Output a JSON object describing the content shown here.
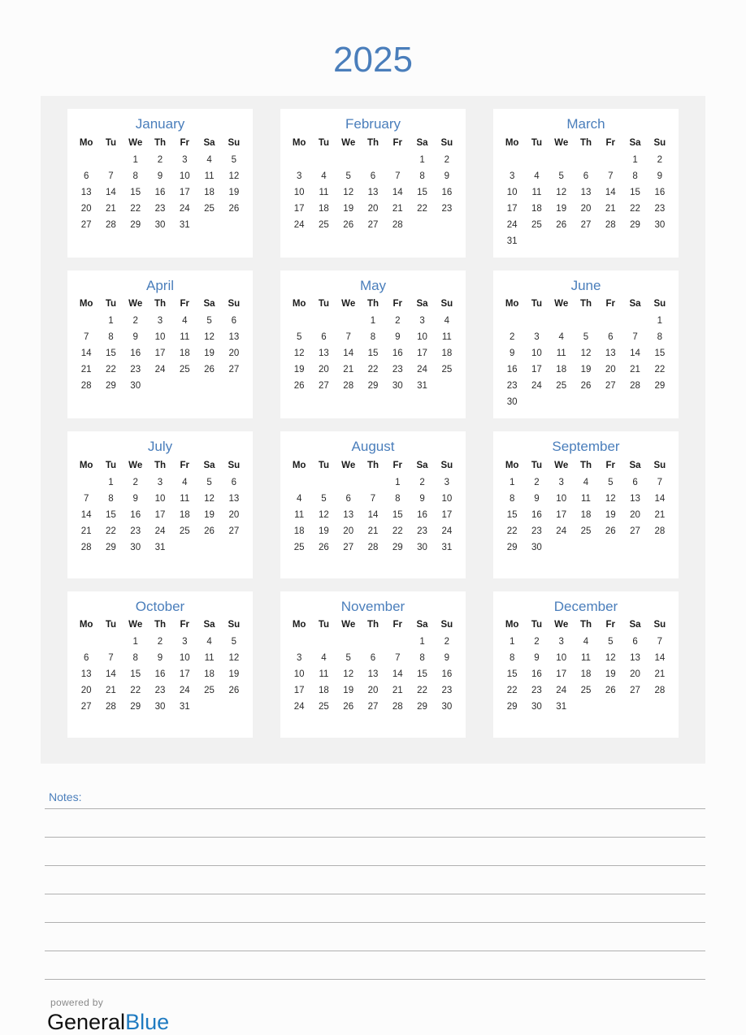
{
  "document": {
    "year_title": "2025",
    "accent_blue": "#4a7ebb",
    "brand_blue": "#1f7bc1",
    "panel_background": "#f1f1f1",
    "page_background": "#fcfcfc"
  },
  "weekday_headers": [
    "Mo",
    "Tu",
    "We",
    "Th",
    "Fr",
    "Sa",
    "Su"
  ],
  "months": [
    {
      "name": "January",
      "start_weekday_index": 2,
      "days_in_month": 31,
      "weeks": [
        [
          "",
          "",
          "1",
          "2",
          "3",
          "4",
          "5"
        ],
        [
          "6",
          "7",
          "8",
          "9",
          "10",
          "11",
          "12"
        ],
        [
          "13",
          "14",
          "15",
          "16",
          "17",
          "18",
          "19"
        ],
        [
          "20",
          "21",
          "22",
          "23",
          "24",
          "25",
          "26"
        ],
        [
          "27",
          "28",
          "29",
          "30",
          "31",
          "",
          ""
        ],
        [
          "",
          "",
          "",
          "",
          "",
          "",
          ""
        ]
      ]
    },
    {
      "name": "February",
      "start_weekday_index": 5,
      "days_in_month": 28,
      "weeks": [
        [
          "",
          "",
          "",
          "",
          "",
          "1",
          "2"
        ],
        [
          "3",
          "4",
          "5",
          "6",
          "7",
          "8",
          "9"
        ],
        [
          "10",
          "11",
          "12",
          "13",
          "14",
          "15",
          "16"
        ],
        [
          "17",
          "18",
          "19",
          "20",
          "21",
          "22",
          "23"
        ],
        [
          "24",
          "25",
          "26",
          "27",
          "28",
          "",
          ""
        ],
        [
          "",
          "",
          "",
          "",
          "",
          "",
          ""
        ]
      ]
    },
    {
      "name": "March",
      "start_weekday_index": 5,
      "days_in_month": 31,
      "weeks": [
        [
          "",
          "",
          "",
          "",
          "",
          "1",
          "2"
        ],
        [
          "3",
          "4",
          "5",
          "6",
          "7",
          "8",
          "9"
        ],
        [
          "10",
          "11",
          "12",
          "13",
          "14",
          "15",
          "16"
        ],
        [
          "17",
          "18",
          "19",
          "20",
          "21",
          "22",
          "23"
        ],
        [
          "24",
          "25",
          "26",
          "27",
          "28",
          "29",
          "30"
        ],
        [
          "31",
          "",
          "",
          "",
          "",
          "",
          ""
        ]
      ]
    },
    {
      "name": "April",
      "start_weekday_index": 1,
      "days_in_month": 30,
      "weeks": [
        [
          "",
          "1",
          "2",
          "3",
          "4",
          "5",
          "6"
        ],
        [
          "7",
          "8",
          "9",
          "10",
          "11",
          "12",
          "13"
        ],
        [
          "14",
          "15",
          "16",
          "17",
          "18",
          "19",
          "20"
        ],
        [
          "21",
          "22",
          "23",
          "24",
          "25",
          "26",
          "27"
        ],
        [
          "28",
          "29",
          "30",
          "",
          "",
          "",
          ""
        ],
        [
          "",
          "",
          "",
          "",
          "",
          "",
          ""
        ]
      ]
    },
    {
      "name": "May",
      "start_weekday_index": 3,
      "days_in_month": 31,
      "weeks": [
        [
          "",
          "",
          "",
          "1",
          "2",
          "3",
          "4"
        ],
        [
          "5",
          "6",
          "7",
          "8",
          "9",
          "10",
          "11"
        ],
        [
          "12",
          "13",
          "14",
          "15",
          "16",
          "17",
          "18"
        ],
        [
          "19",
          "20",
          "21",
          "22",
          "23",
          "24",
          "25"
        ],
        [
          "26",
          "27",
          "28",
          "29",
          "30",
          "31",
          ""
        ],
        [
          "",
          "",
          "",
          "",
          "",
          "",
          ""
        ]
      ]
    },
    {
      "name": "June",
      "start_weekday_index": 6,
      "days_in_month": 30,
      "weeks": [
        [
          "",
          "",
          "",
          "",
          "",
          "",
          "1"
        ],
        [
          "2",
          "3",
          "4",
          "5",
          "6",
          "7",
          "8"
        ],
        [
          "9",
          "10",
          "11",
          "12",
          "13",
          "14",
          "15"
        ],
        [
          "16",
          "17",
          "18",
          "19",
          "20",
          "21",
          "22"
        ],
        [
          "23",
          "24",
          "25",
          "26",
          "27",
          "28",
          "29"
        ],
        [
          "30",
          "",
          "",
          "",
          "",
          "",
          ""
        ]
      ]
    },
    {
      "name": "July",
      "start_weekday_index": 1,
      "days_in_month": 31,
      "weeks": [
        [
          "",
          "1",
          "2",
          "3",
          "4",
          "5",
          "6"
        ],
        [
          "7",
          "8",
          "9",
          "10",
          "11",
          "12",
          "13"
        ],
        [
          "14",
          "15",
          "16",
          "17",
          "18",
          "19",
          "20"
        ],
        [
          "21",
          "22",
          "23",
          "24",
          "25",
          "26",
          "27"
        ],
        [
          "28",
          "29",
          "30",
          "31",
          "",
          "",
          ""
        ],
        [
          "",
          "",
          "",
          "",
          "",
          "",
          ""
        ]
      ]
    },
    {
      "name": "August",
      "start_weekday_index": 4,
      "days_in_month": 31,
      "weeks": [
        [
          "",
          "",
          "",
          "",
          "1",
          "2",
          "3"
        ],
        [
          "4",
          "5",
          "6",
          "7",
          "8",
          "9",
          "10"
        ],
        [
          "11",
          "12",
          "13",
          "14",
          "15",
          "16",
          "17"
        ],
        [
          "18",
          "19",
          "20",
          "21",
          "22",
          "23",
          "24"
        ],
        [
          "25",
          "26",
          "27",
          "28",
          "29",
          "30",
          "31"
        ],
        [
          "",
          "",
          "",
          "",
          "",
          "",
          ""
        ]
      ]
    },
    {
      "name": "September",
      "start_weekday_index": 0,
      "days_in_month": 30,
      "weeks": [
        [
          "1",
          "2",
          "3",
          "4",
          "5",
          "6",
          "7"
        ],
        [
          "8",
          "9",
          "10",
          "11",
          "12",
          "13",
          "14"
        ],
        [
          "15",
          "16",
          "17",
          "18",
          "19",
          "20",
          "21"
        ],
        [
          "22",
          "23",
          "24",
          "25",
          "26",
          "27",
          "28"
        ],
        [
          "29",
          "30",
          "",
          "",
          "",
          "",
          ""
        ],
        [
          "",
          "",
          "",
          "",
          "",
          "",
          ""
        ]
      ]
    },
    {
      "name": "October",
      "start_weekday_index": 2,
      "days_in_month": 31,
      "weeks": [
        [
          "",
          "",
          "1",
          "2",
          "3",
          "4",
          "5"
        ],
        [
          "6",
          "7",
          "8",
          "9",
          "10",
          "11",
          "12"
        ],
        [
          "13",
          "14",
          "15",
          "16",
          "17",
          "18",
          "19"
        ],
        [
          "20",
          "21",
          "22",
          "23",
          "24",
          "25",
          "26"
        ],
        [
          "27",
          "28",
          "29",
          "30",
          "31",
          "",
          ""
        ],
        [
          "",
          "",
          "",
          "",
          "",
          "",
          ""
        ]
      ]
    },
    {
      "name": "November",
      "start_weekday_index": 5,
      "days_in_month": 30,
      "weeks": [
        [
          "",
          "",
          "",
          "",
          "",
          "1",
          "2"
        ],
        [
          "3",
          "4",
          "5",
          "6",
          "7",
          "8",
          "9"
        ],
        [
          "10",
          "11",
          "12",
          "13",
          "14",
          "15",
          "16"
        ],
        [
          "17",
          "18",
          "19",
          "20",
          "21",
          "22",
          "23"
        ],
        [
          "24",
          "25",
          "26",
          "27",
          "28",
          "29",
          "30"
        ],
        [
          "",
          "",
          "",
          "",
          "",
          "",
          ""
        ]
      ]
    },
    {
      "name": "December",
      "start_weekday_index": 0,
      "days_in_month": 31,
      "weeks": [
        [
          "1",
          "2",
          "3",
          "4",
          "5",
          "6",
          "7"
        ],
        [
          "8",
          "9",
          "10",
          "11",
          "12",
          "13",
          "14"
        ],
        [
          "15",
          "16",
          "17",
          "18",
          "19",
          "20",
          "21"
        ],
        [
          "22",
          "23",
          "24",
          "25",
          "26",
          "27",
          "28"
        ],
        [
          "29",
          "30",
          "31",
          "",
          "",
          "",
          ""
        ],
        [
          "",
          "",
          "",
          "",
          "",
          "",
          ""
        ]
      ]
    }
  ],
  "notes": {
    "label": "Notes:",
    "line_count": 6
  },
  "footer": {
    "powered_by": "powered by",
    "brand_first": "General",
    "brand_second": "Blue"
  }
}
